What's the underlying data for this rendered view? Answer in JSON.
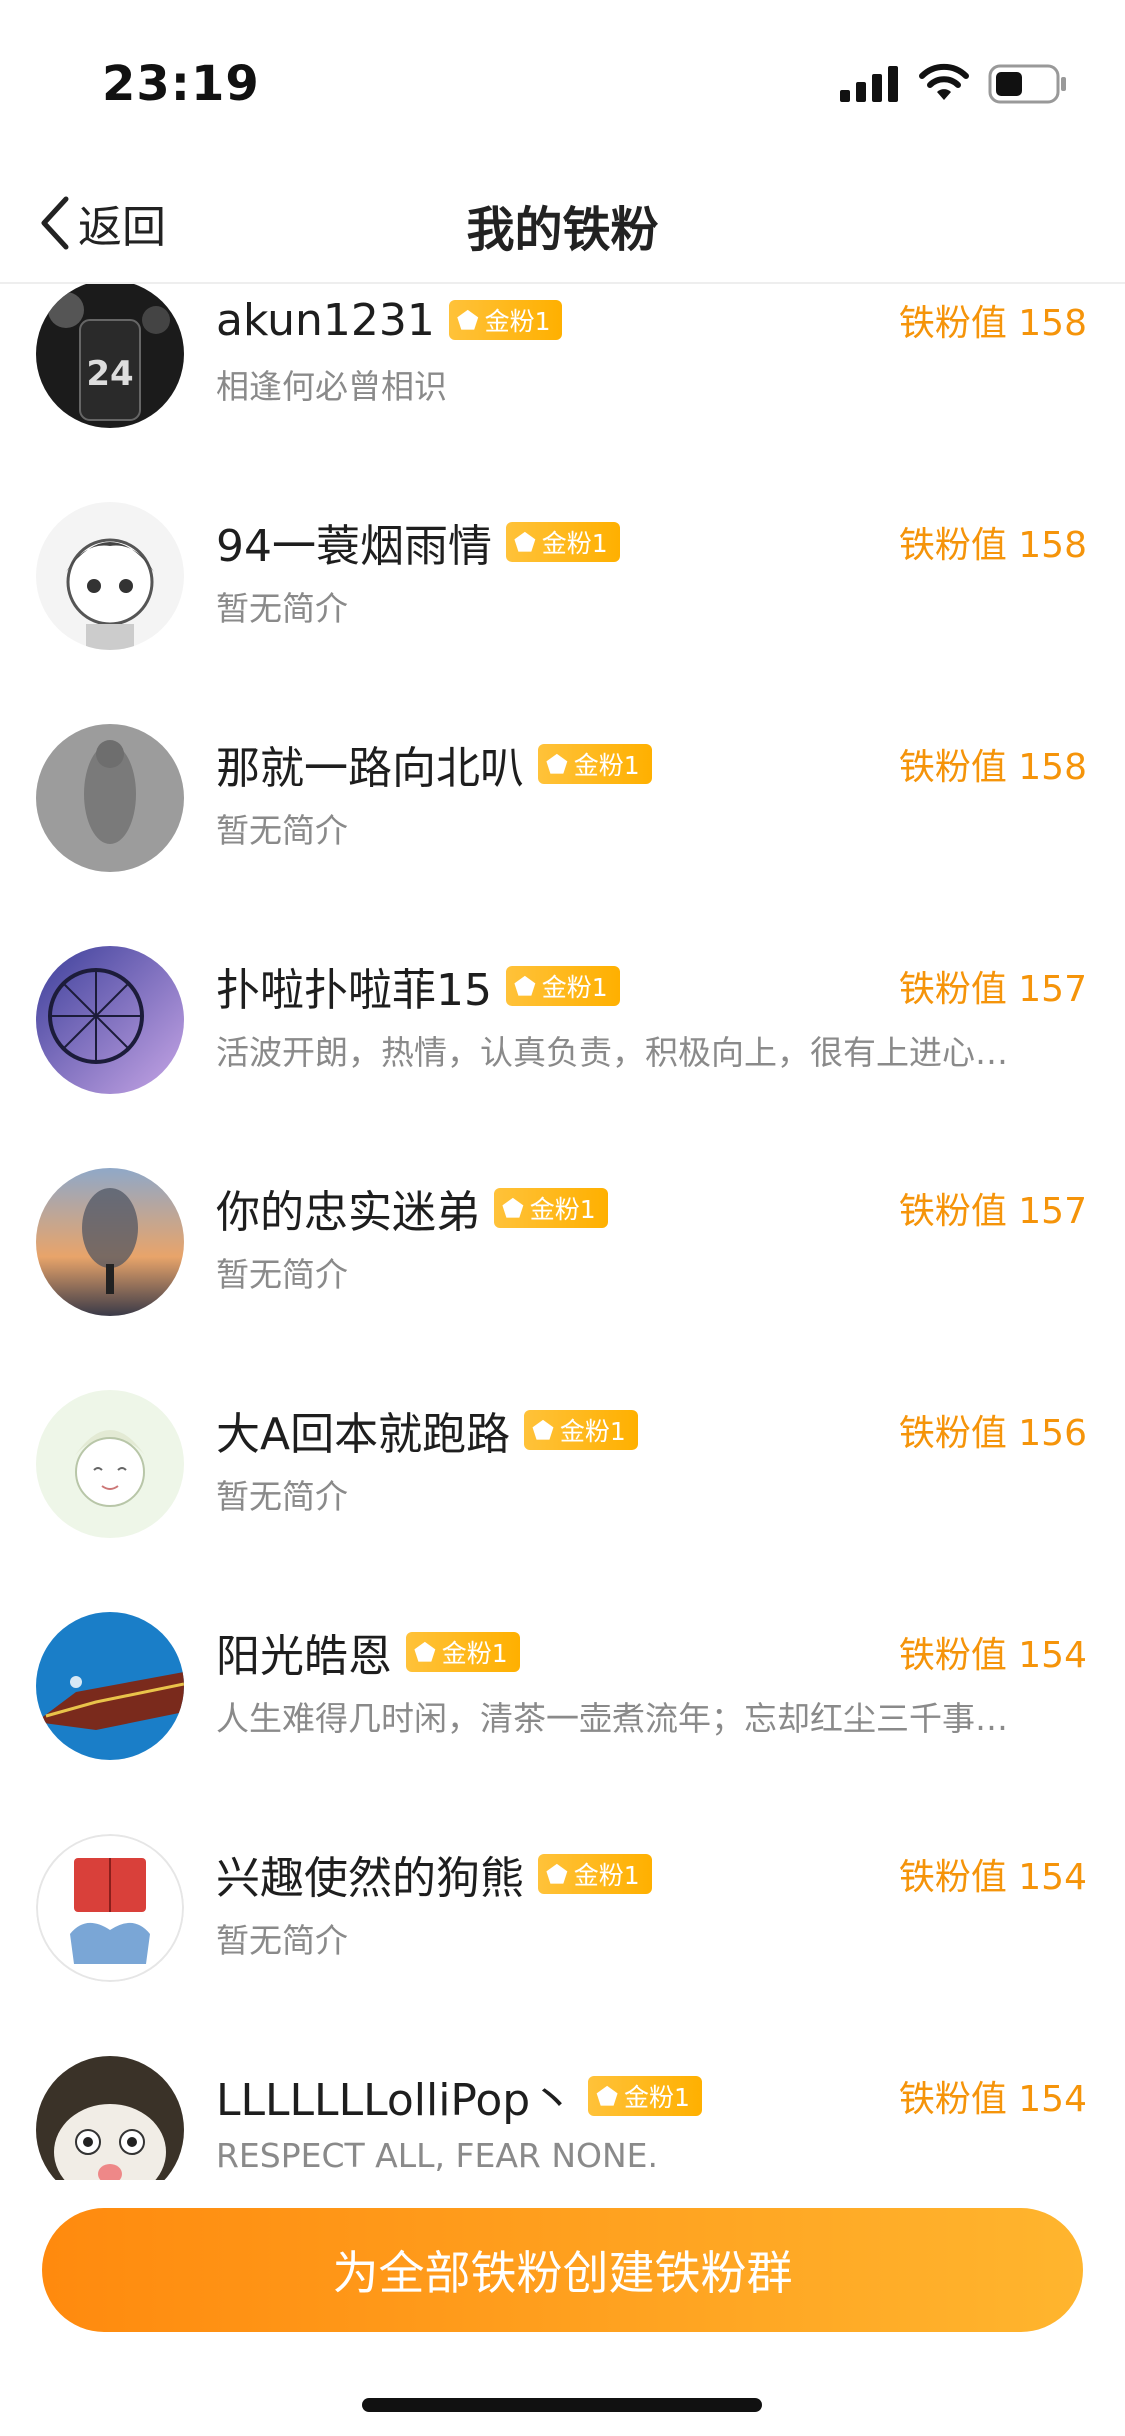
{
  "status": {
    "time": "23:19"
  },
  "nav": {
    "back_label": "返回",
    "title": "我的铁粉"
  },
  "colors": {
    "accent": "#f5940a",
    "badge": "#ffb000",
    "cta_start": "#ff8a0e",
    "cta_end": "#ffb52e"
  },
  "fans": [
    {
      "name": "akun1231",
      "badge": "金粉1",
      "score": "铁粉值 158",
      "bio": "相逢何必曾相识",
      "avatar": "basketball-jersey-photo"
    },
    {
      "name": "94一蓑烟雨情",
      "badge": "金粉1",
      "score": "铁粉值 158",
      "bio": "暂无简介",
      "avatar": "anime-boy-sketch"
    },
    {
      "name": "那就一路向北叭",
      "badge": "金粉1",
      "score": "铁粉值 158",
      "bio": "暂无简介",
      "avatar": "grey-shadow-photo"
    },
    {
      "name": "扑啦扑啦菲15",
      "badge": "金粉1",
      "score": "铁粉值 157",
      "bio": "活波开朗，热情，认真负责，积极向上，很有上进心…",
      "avatar": "ferris-wheel-photo"
    },
    {
      "name": "你的忠实迷弟",
      "badge": "金粉1",
      "score": "铁粉值 157",
      "bio": "暂无简介",
      "avatar": "sunset-silhouette-photo"
    },
    {
      "name": "大A回本就跑路",
      "badge": "金粉1",
      "score": "铁粉值 156",
      "bio": "暂无简介",
      "avatar": "anime-smile-drawing"
    },
    {
      "name": "阳光皓恩",
      "badge": "金粉1",
      "score": "铁粉值 154",
      "bio": "人生难得几时闲，清茶一壶煮流年；忘却红尘三千事…",
      "avatar": "temple-roof-photo"
    },
    {
      "name": "兴趣使然的狗熊",
      "badge": "金粉1",
      "score": "铁粉值 154",
      "bio": "暂无简介",
      "avatar": "reading-book-drawing"
    },
    {
      "name": "LLLLLLLolliPop丶",
      "badge": "金粉1",
      "score": "铁粉值 154",
      "bio": "RESPECT ALL, FEAR NONE.",
      "avatar": "surprised-cat-photo"
    }
  ],
  "cta": {
    "label": "为全部铁粉创建铁粉群"
  }
}
